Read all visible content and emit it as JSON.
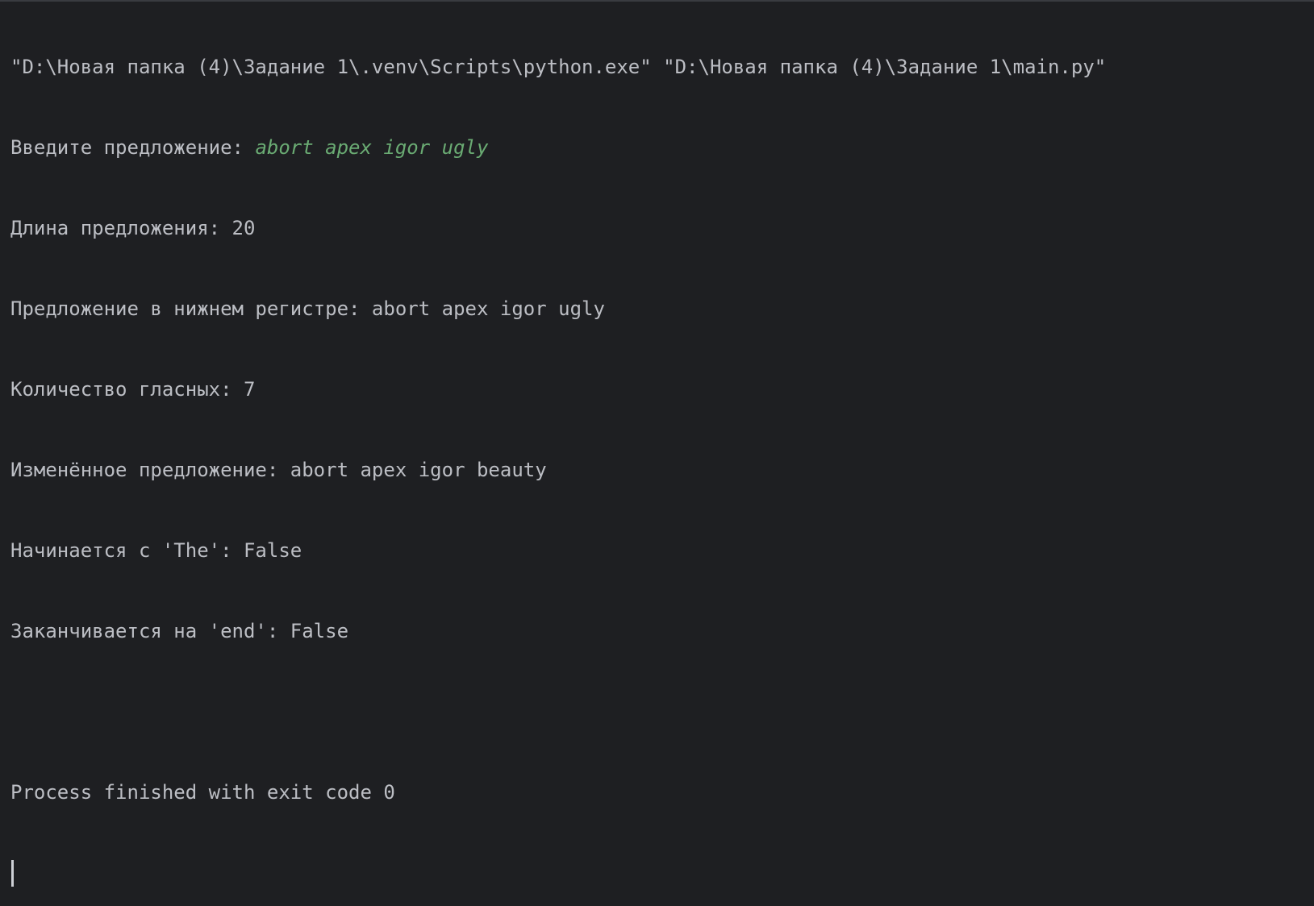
{
  "console": {
    "command_line": "\"D:\\Новая папка (4)\\Задание 1\\.venv\\Scripts\\python.exe\" \"D:\\Новая папка (4)\\Задание 1\\main.py\"",
    "prompt": {
      "label": "Введите предложение: ",
      "input": "abort apex igor ugly"
    },
    "output_lines": [
      "Длина предложения: 20",
      "Предложение в нижнем регистре: abort apex igor ugly",
      "Количество гласных: 7",
      "Изменённое предложение: abort apex igor beauty",
      "Начинается с 'The': False",
      "Заканчивается на 'end': False"
    ],
    "exit_message": "Process finished with exit code 0"
  },
  "colors": {
    "background": "#1e1f22",
    "text": "#bcbec4",
    "user_input": "#6aab73"
  }
}
